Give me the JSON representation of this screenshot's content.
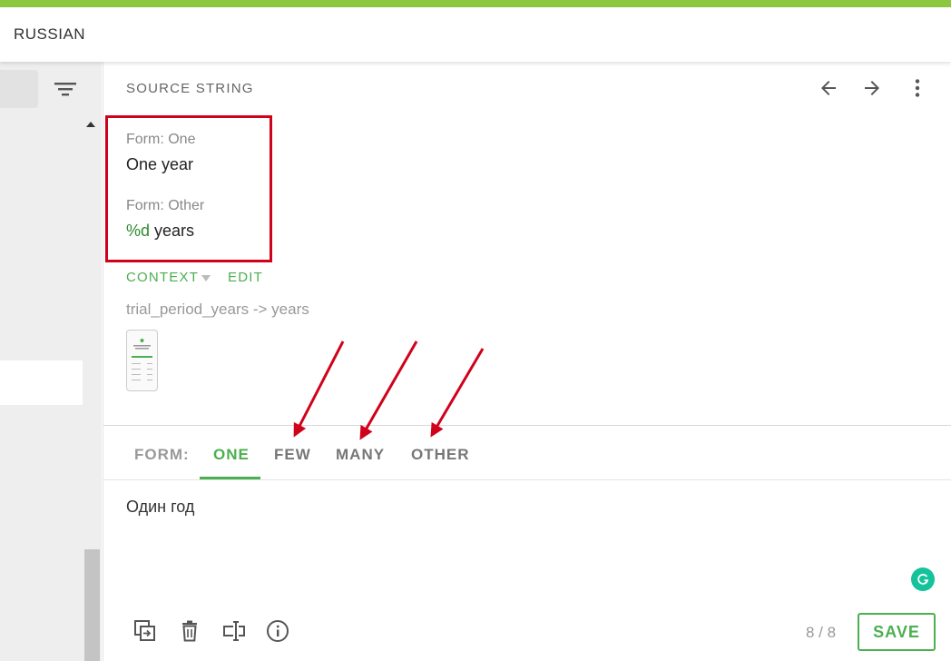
{
  "header": {
    "title": "RUSSIAN"
  },
  "sidebar": {
    "filter_icon": "filter-icon"
  },
  "source": {
    "section_label": "SOURCE STRING",
    "forms": [
      {
        "label": "Form: One",
        "text": "One year"
      },
      {
        "label": "Form: Other",
        "placeholder": "%d",
        "text": " years"
      }
    ]
  },
  "context": {
    "label": "CONTEXT",
    "edit_label": "EDIT",
    "text": "trial_period_years -> years"
  },
  "tabs": {
    "prefix": "FORM:",
    "items": [
      {
        "label": "ONE",
        "active": true
      },
      {
        "label": "FEW",
        "active": false
      },
      {
        "label": "MANY",
        "active": false
      },
      {
        "label": "OTHER",
        "active": false
      }
    ]
  },
  "translation": {
    "text": "Один год"
  },
  "footer": {
    "counter": "8 / 8",
    "save_label": "SAVE"
  },
  "colors": {
    "accent": "#4caf50",
    "top_strip": "#8dc63f",
    "annotation": "#d0021b",
    "grammarly": "#15c39a"
  }
}
